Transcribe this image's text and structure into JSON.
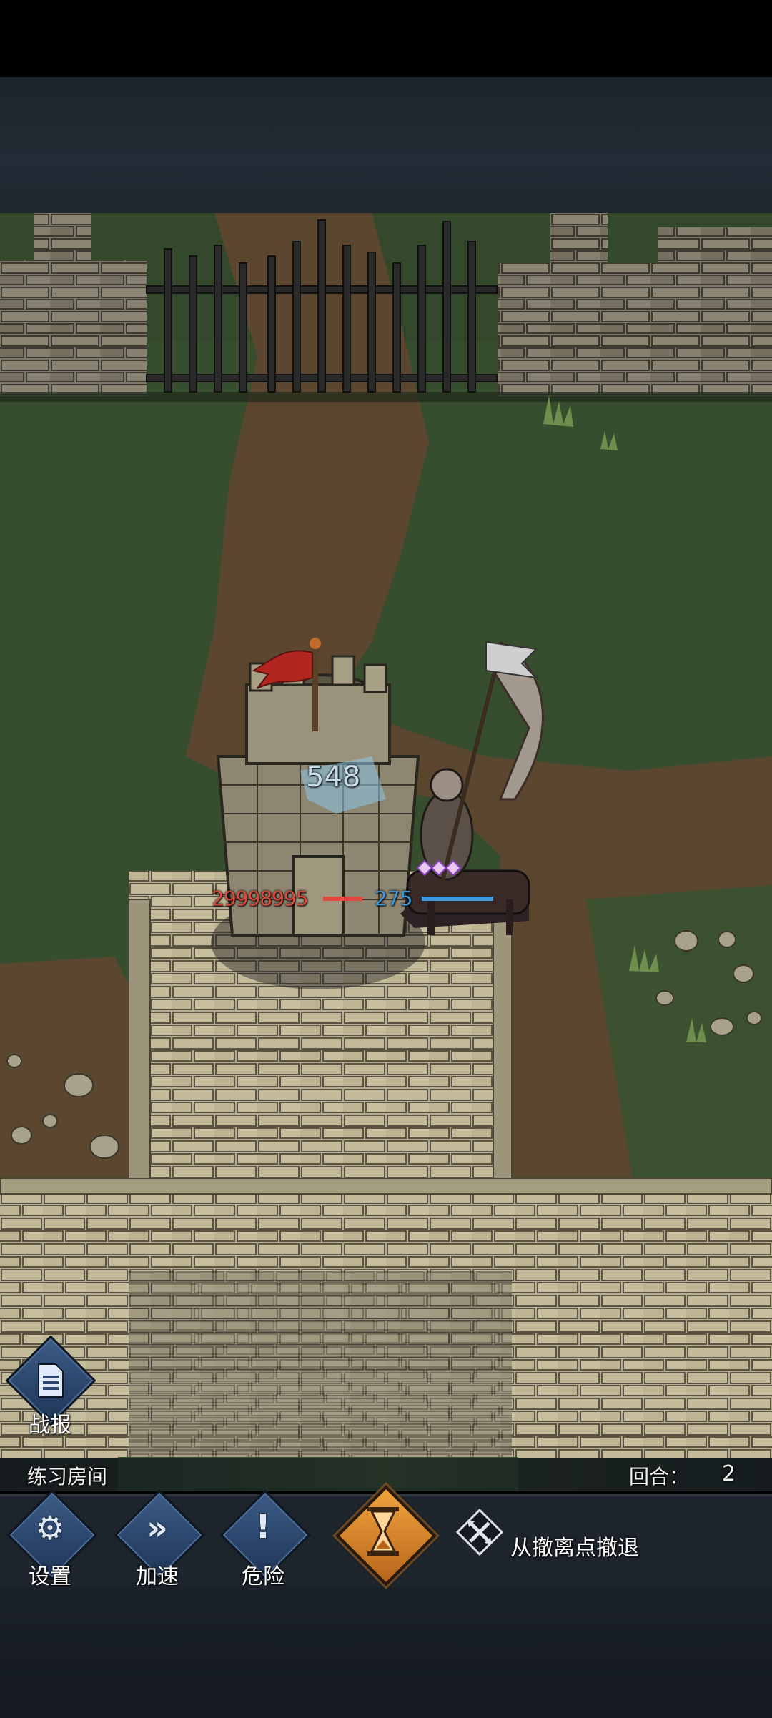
{
  "battle": {
    "damage_number": "548",
    "enemy_hp": "29998995",
    "player_hp": "275"
  },
  "bottom": {
    "room_title": "练习房间",
    "round_label": "回合：",
    "round_value": "2",
    "report_label": "战报",
    "buttons": {
      "settings": "设置",
      "speed": "加速",
      "danger": "危险"
    },
    "retreat_text": "从撤离点撤退"
  },
  "colors": {
    "enemy_hp": "#e04a3e",
    "player_hp": "#3d9ae0",
    "end_turn": "#f1a33c"
  },
  "icons": {
    "report": "document-icon",
    "settings": "gear-icon",
    "speed": "fast-forward-icon",
    "danger": "exclamation-icon",
    "end_turn": "hourglass-icon",
    "retreat": "crossed-arrows-icon"
  }
}
